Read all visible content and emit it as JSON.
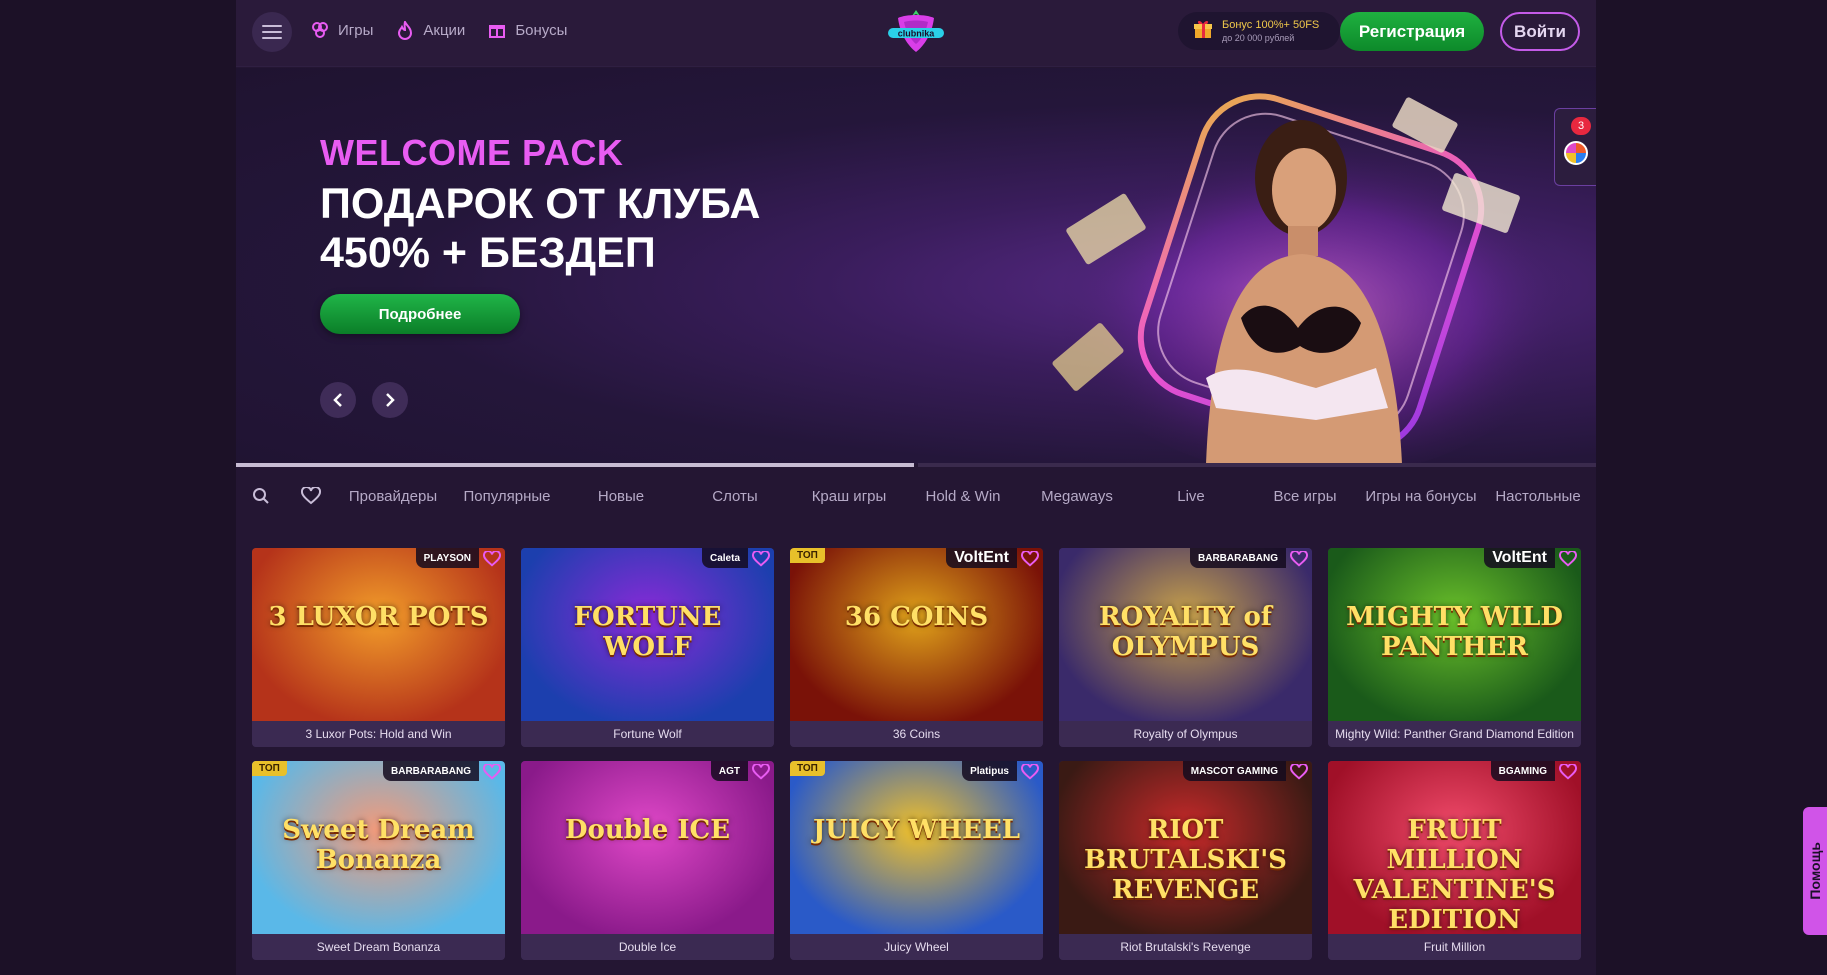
{
  "header": {
    "nav": [
      {
        "label": "Игры",
        "icon": "games-icon"
      },
      {
        "label": "Акции",
        "icon": "flame-icon"
      },
      {
        "label": "Бонусы",
        "icon": "gift-icon"
      }
    ],
    "logo_text": "clubnika",
    "bonus": {
      "main": "Бонус 100%+ 50FS",
      "sub": "до 20 000 рублей"
    },
    "register_label": "Регистрация",
    "login_label": "Войти"
  },
  "hero": {
    "kicker": "WELCOME PACK",
    "title_line1": "ПОДАРОК ОТ КЛУБА",
    "title_line2": "450% + БЕЗДЕП",
    "button_label": "Подробнее",
    "side_badge_count": "3"
  },
  "categories": [
    "Провайдеры",
    "Популярные",
    "Новые",
    "Слоты",
    "Краш игры",
    "Hold & Win",
    "Megaways",
    "Live",
    "Все игры",
    "Игры на бонусы",
    "Настольные"
  ],
  "games": [
    {
      "name": "3 Luxor Pots: Hold and Win",
      "art": "3 LUXOR POTS",
      "provider": "PLAYSON",
      "top": false,
      "bg": "#b5331a",
      "bg2": "#f29d2a"
    },
    {
      "name": "Fortune Wolf",
      "art": "FORTUNE WOLF",
      "provider": "Caleta",
      "top": false,
      "bg": "#1c3fae",
      "bg2": "#8a2ad8"
    },
    {
      "name": "36 Coins",
      "art": "36 COINS",
      "provider": "VoltEnt",
      "top": true,
      "bg": "#7a1208",
      "bg2": "#e0a21a"
    },
    {
      "name": "Royalty of Olympus",
      "art": "ROYALTY of OLYMPUS",
      "provider": "BARBARABANG",
      "top": false,
      "bg": "#3a2a6a",
      "bg2": "#c9a24a"
    },
    {
      "name": "Mighty Wild: Panther Grand Diamond Edition",
      "art": "MIGHTY WILD PANTHER",
      "provider": "VoltEnt",
      "top": false,
      "bg": "#1a5a1a",
      "bg2": "#6ac02a"
    },
    {
      "name": "Sweet Dream Bonanza",
      "art": "Sweet Dream Bonanza",
      "provider": "BARBARABANG",
      "top": true,
      "bg": "#5ab8e8",
      "bg2": "#f29a7a"
    },
    {
      "name": "Double Ice",
      "art": "Double ICE",
      "provider": "AGT",
      "top": false,
      "bg": "#8a1a8a",
      "bg2": "#e048c8"
    },
    {
      "name": "Juicy Wheel",
      "art": "JUICY WHEEL",
      "provider": "Platipus",
      "top": true,
      "bg": "#2a5ac8",
      "bg2": "#f0c02a"
    },
    {
      "name": "Riot Brutalski's Revenge",
      "art": "RIOT BRUTALSKI'S REVENGE",
      "provider": "MASCOT GAMING",
      "top": false,
      "bg": "#3a1a14",
      "bg2": "#c82a2a"
    },
    {
      "name": "Fruit Million",
      "art": "FRUIT MILLION VALENTINE'S EDITION",
      "provider": "BGAMING",
      "top": false,
      "bg": "#a01028",
      "bg2": "#f04a6a"
    }
  ],
  "top_label": "ТОП",
  "help_label": "Помощь",
  "colors": {
    "accent": "#e85cf2",
    "green": "#1fb040",
    "bg": "#1c1127"
  }
}
